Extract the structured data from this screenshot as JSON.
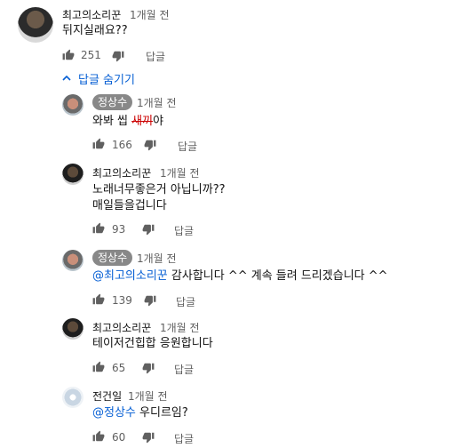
{
  "comments": [
    {
      "author": "최고의소리꾼",
      "time": "1개월 전",
      "text": "뒤지실래요??",
      "likes": "251",
      "reply_label": "답글"
    }
  ],
  "replies_toggle": "답글 숨기기",
  "replies": [
    {
      "author": "정상수",
      "author_badge": true,
      "time": "1개월 전",
      "text_pre": "와봐 씹 ",
      "text_strike": "새끼",
      "text_post": "야",
      "likes": "166",
      "reply_label": "답글"
    },
    {
      "author": "최고의소리꾼",
      "time": "1개월 전",
      "line1": "노래너무좋은거 아닙니까??",
      "line2": "매일들을겁니다",
      "likes": "93",
      "reply_label": "답글"
    },
    {
      "author": "정상수",
      "author_badge": true,
      "time": "1개월 전",
      "mention": "@최고의소리꾼",
      "text": " 감사합니다 ^^ 계속 들려 드리겠습니다 ^^",
      "likes": "139",
      "reply_label": "답글"
    },
    {
      "author": "최고의소리꾼",
      "time": "1개월 전",
      "text": "테이저건힙합 응원합니다",
      "likes": "65",
      "reply_label": "답글"
    },
    {
      "author": "전건일",
      "time": "1개월 전",
      "mention": "@정상수",
      "text": " 우디르임?",
      "likes": "60",
      "reply_label": "답글"
    }
  ],
  "colors": {
    "link": "#065fd4",
    "badge": "#888888",
    "strike": "#cc0000",
    "meta": "#606060"
  },
  "icons": [
    "thumbs-up-icon",
    "thumbs-down-icon",
    "chevron-up-icon"
  ]
}
